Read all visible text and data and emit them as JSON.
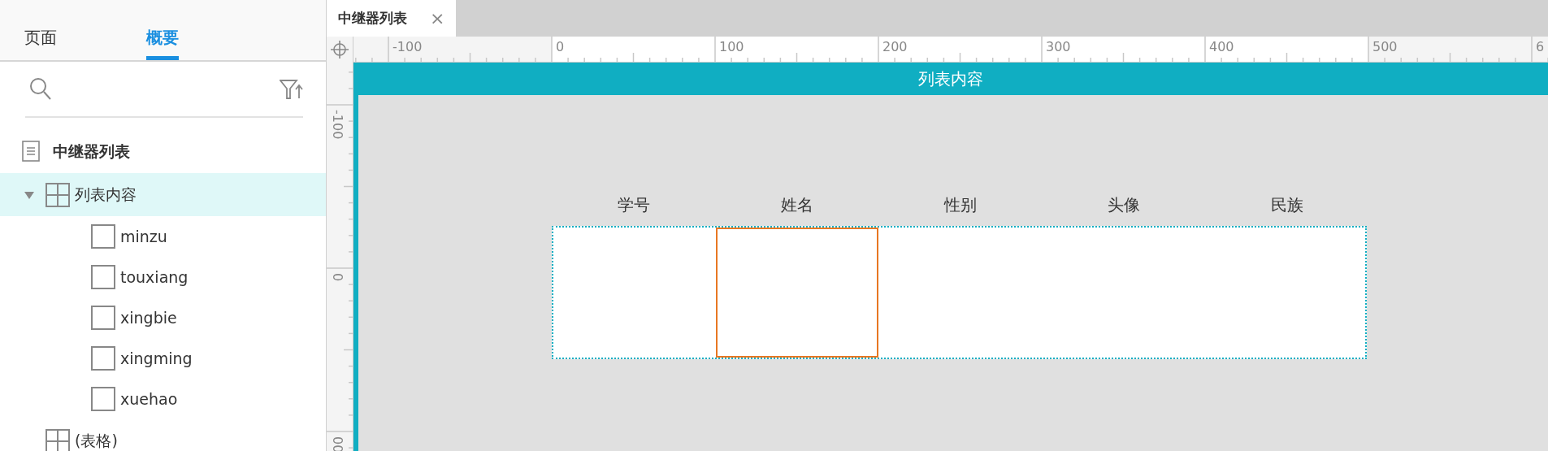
{
  "panel_tabs": [
    {
      "label": "页面",
      "selected": false
    },
    {
      "label": "概要",
      "selected": true
    }
  ],
  "outline": {
    "root": "中继器列表",
    "items": [
      {
        "label": "列表内容",
        "kind": "repeater",
        "expanded": true,
        "selected": true,
        "children": [
          {
            "label": "minzu",
            "kind": "shape"
          },
          {
            "label": "touxiang",
            "kind": "shape"
          },
          {
            "label": "xingbie",
            "kind": "shape"
          },
          {
            "label": "xingming",
            "kind": "shape"
          },
          {
            "label": "xuehao",
            "kind": "shape"
          }
        ]
      },
      {
        "label": "(表格)",
        "kind": "repeater",
        "selected": false
      }
    ]
  },
  "doc_tabs": [
    {
      "label": "中继器列表",
      "close": "×",
      "selected": true
    }
  ],
  "ruler": {
    "horizontal": [
      "-100",
      "0",
      "100",
      "200",
      "300",
      "400",
      "500",
      "6"
    ],
    "vertical": [
      "-100",
      "0",
      "00"
    ]
  },
  "canvas": {
    "banner": "列表内容",
    "columns": [
      "学号",
      "姓名",
      "性别",
      "头像",
      "民族"
    ],
    "cells": [
      {
        "selected": false
      },
      {
        "selected": true
      },
      {
        "selected": false
      },
      {
        "selected": false
      },
      {
        "selected": false
      }
    ]
  }
}
